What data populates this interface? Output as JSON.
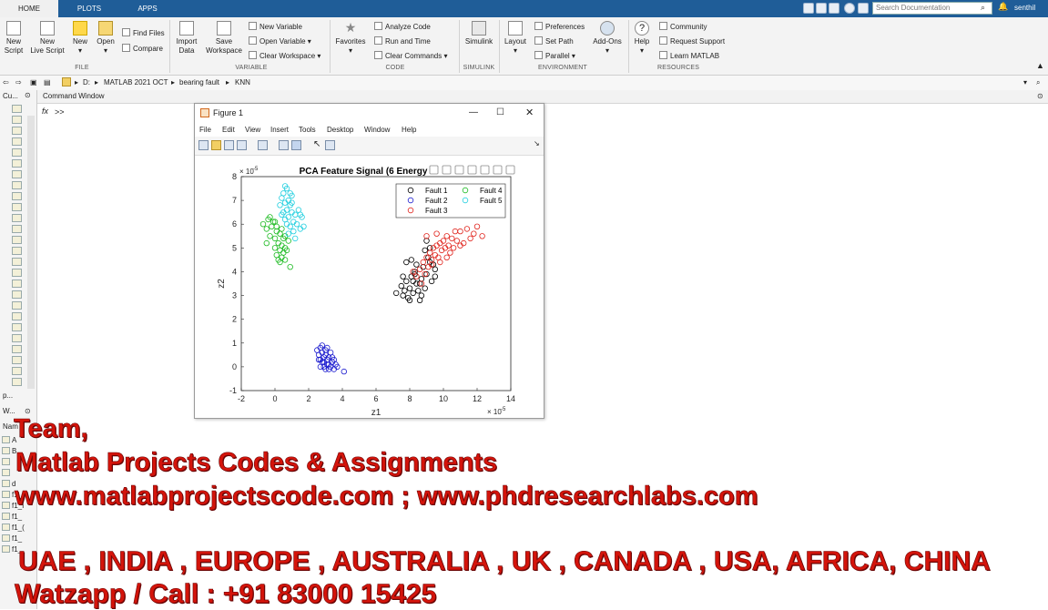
{
  "tabs": [
    {
      "label": "HOME",
      "active": true
    },
    {
      "label": "PLOTS",
      "active": false
    },
    {
      "label": "APPS",
      "active": false
    }
  ],
  "search": {
    "placeholder": "Search Documentation"
  },
  "user": {
    "name": "senthil"
  },
  "ribbon": {
    "file": {
      "group": "FILE",
      "new_script": "New\nScript",
      "new_live_script": "New\nLive Script",
      "new": "New",
      "open": "Open",
      "find_files": "Find Files",
      "compare": "Compare"
    },
    "variable": {
      "group": "VARIABLE",
      "import_data": "Import\nData",
      "save_workspace": "Save\nWorkspace",
      "new_variable": "New Variable",
      "open_variable": "Open Variable ▾",
      "clear_workspace": "Clear Workspace ▾"
    },
    "code": {
      "group": "CODE",
      "favorites": "Favorites",
      "analyze_code": "Analyze Code",
      "run_and_time": "Run and Time",
      "clear_commands": "Clear Commands ▾"
    },
    "simulink": {
      "group": "SIMULINK",
      "simulink": "Simulink"
    },
    "environment": {
      "group": "ENVIRONMENT",
      "layout": "Layout",
      "preferences": "Preferences",
      "set_path": "Set Path",
      "parallel": "Parallel ▾",
      "add_ons": "Add-Ons"
    },
    "resources": {
      "group": "RESOURCES",
      "help": "Help",
      "community": "Community",
      "request_support": "Request Support",
      "learn_matlab": "Learn MATLAB"
    }
  },
  "address": {
    "drive": "D:",
    "folder1": "MATLAB 2021 OCT",
    "folder2": "bearing fault",
    "folder3": "KNN"
  },
  "left_panel": {
    "current_folder": "Cu...",
    "workspace_short": "p...",
    "workspace": "W...",
    "name_col": "Nam",
    "items": [
      "A",
      "B",
      "",
      "",
      "d",
      "f1_",
      "f1_I",
      "f1_",
      "f1_(",
      "f1_",
      "f1_"
    ]
  },
  "command_window": {
    "title": "Command Window",
    "prompt": ">>",
    "fx": "fx"
  },
  "figure": {
    "title": "Figure 1",
    "menu": [
      "File",
      "Edit",
      "View",
      "Insert",
      "Tools",
      "Desktop",
      "Window",
      "Help"
    ]
  },
  "chart_data": {
    "type": "scatter",
    "title": "PCA Feature Signal (6 Energy",
    "xlabel": "z1",
    "ylabel": "z2",
    "x_exponent": "× 10",
    "x_exponent_power": "-5",
    "y_exponent": "× 10",
    "y_exponent_power": "-5",
    "xlim": [
      -2,
      14
    ],
    "ylim": [
      -1,
      8
    ],
    "xticks": [
      "-2",
      "0",
      "2",
      "4",
      "6",
      "8",
      "10",
      "12",
      "14"
    ],
    "yticks": [
      "-1",
      "0",
      "1",
      "2",
      "3",
      "4",
      "5",
      "6",
      "7",
      "8"
    ],
    "legend_position": "top-right",
    "marker": "open circle",
    "series": [
      {
        "name": "Fault 1",
        "color": "#000000",
        "points": [
          [
            7.2,
            3.1
          ],
          [
            7.5,
            3.4
          ],
          [
            7.6,
            3.0
          ],
          [
            7.8,
            3.6
          ],
          [
            7.9,
            2.9
          ],
          [
            8.0,
            3.3
          ],
          [
            8.1,
            3.8
          ],
          [
            8.2,
            3.1
          ],
          [
            8.3,
            4.0
          ],
          [
            8.4,
            3.5
          ],
          [
            8.5,
            3.2
          ],
          [
            8.6,
            2.8
          ],
          [
            8.7,
            3.7
          ],
          [
            8.8,
            4.2
          ],
          [
            8.9,
            3.3
          ],
          [
            9.0,
            3.9
          ],
          [
            9.1,
            4.6
          ],
          [
            9.2,
            4.4
          ],
          [
            9.3,
            3.6
          ],
          [
            9.5,
            4.1
          ],
          [
            7.8,
            4.4
          ],
          [
            8.1,
            4.5
          ],
          [
            8.0,
            2.8
          ],
          [
            8.6,
            3.5
          ],
          [
            9.0,
            5.3
          ],
          [
            9.5,
            3.8
          ],
          [
            8.3,
            3.9
          ],
          [
            8.7,
            3.0
          ],
          [
            7.7,
            3.2
          ],
          [
            9.4,
            4.3
          ],
          [
            8.2,
            3.6
          ],
          [
            8.9,
            4.9
          ],
          [
            8.4,
            4.3
          ],
          [
            7.6,
            3.8
          ],
          [
            9.2,
            5.0
          ]
        ]
      },
      {
        "name": "Fault 2",
        "color": "#1c1ccf",
        "points": [
          [
            2.5,
            0.7
          ],
          [
            2.6,
            0.5
          ],
          [
            2.7,
            0.8
          ],
          [
            2.7,
            0.3
          ],
          [
            2.8,
            0.6
          ],
          [
            2.8,
            0.9
          ],
          [
            2.9,
            0.4
          ],
          [
            2.9,
            0.2
          ],
          [
            3.0,
            0.7
          ],
          [
            3.0,
            0.5
          ],
          [
            3.1,
            0.3
          ],
          [
            3.1,
            0.8
          ],
          [
            3.2,
            0.1
          ],
          [
            3.2,
            0.4
          ],
          [
            3.3,
            0.0
          ],
          [
            3.3,
            0.6
          ],
          [
            3.4,
            0.2
          ],
          [
            3.5,
            -0.1
          ],
          [
            3.6,
            0.1
          ],
          [
            3.7,
            0.0
          ],
          [
            2.9,
            0.0
          ],
          [
            3.0,
            -0.1
          ],
          [
            4.1,
            -0.2
          ],
          [
            2.8,
            0.2
          ],
          [
            3.4,
            0.4
          ],
          [
            2.6,
            0.3
          ],
          [
            3.1,
            0.1
          ],
          [
            3.5,
            0.3
          ],
          [
            3.2,
            -0.1
          ],
          [
            2.7,
            0.0
          ]
        ]
      },
      {
        "name": "Fault 3",
        "color": "#e0231c",
        "points": [
          [
            8.4,
            3.8
          ],
          [
            8.6,
            4.1
          ],
          [
            8.8,
            4.4
          ],
          [
            8.9,
            3.9
          ],
          [
            9.0,
            4.6
          ],
          [
            9.1,
            4.2
          ],
          [
            9.2,
            4.8
          ],
          [
            9.3,
            4.5
          ],
          [
            9.4,
            5.0
          ],
          [
            9.5,
            4.7
          ],
          [
            9.6,
            5.1
          ],
          [
            9.7,
            4.6
          ],
          [
            9.8,
            5.2
          ],
          [
            9.9,
            4.9
          ],
          [
            10.0,
            5.3
          ],
          [
            10.1,
            5.0
          ],
          [
            10.2,
            5.5
          ],
          [
            10.3,
            5.1
          ],
          [
            10.4,
            4.8
          ],
          [
            10.5,
            5.4
          ],
          [
            10.6,
            5.0
          ],
          [
            10.8,
            5.3
          ],
          [
            11.0,
            5.7
          ],
          [
            11.2,
            5.2
          ],
          [
            11.4,
            5.8
          ],
          [
            11.6,
            5.4
          ],
          [
            11.8,
            5.6
          ],
          [
            12.0,
            5.9
          ],
          [
            12.3,
            5.5
          ],
          [
            8.7,
            3.5
          ],
          [
            9.0,
            5.5
          ],
          [
            9.6,
            5.6
          ],
          [
            10.2,
            4.6
          ],
          [
            11.0,
            5.1
          ],
          [
            9.3,
            4.3
          ],
          [
            8.2,
            4.0
          ],
          [
            10.7,
            5.7
          ],
          [
            9.8,
            4.4
          ]
        ]
      },
      {
        "name": "Fault 4",
        "color": "#1dbb22",
        "points": [
          [
            -0.7,
            6.0
          ],
          [
            -0.5,
            5.8
          ],
          [
            -0.4,
            6.2
          ],
          [
            -0.3,
            5.5
          ],
          [
            -0.2,
            5.9
          ],
          [
            -0.1,
            6.1
          ],
          [
            0.0,
            5.4
          ],
          [
            0.0,
            5.0
          ],
          [
            0.1,
            5.7
          ],
          [
            0.1,
            4.7
          ],
          [
            0.2,
            5.2
          ],
          [
            0.2,
            4.5
          ],
          [
            0.3,
            5.6
          ],
          [
            0.3,
            4.9
          ],
          [
            0.4,
            5.1
          ],
          [
            0.4,
            4.6
          ],
          [
            0.5,
            5.4
          ],
          [
            0.5,
            4.8
          ],
          [
            0.6,
            5.0
          ],
          [
            0.6,
            4.5
          ],
          [
            0.7,
            4.9
          ],
          [
            0.8,
            5.3
          ],
          [
            0.9,
            4.2
          ],
          [
            -0.3,
            6.3
          ],
          [
            0.0,
            6.1
          ],
          [
            0.3,
            4.4
          ],
          [
            0.1,
            5.9
          ],
          [
            -0.5,
            5.2
          ],
          [
            0.4,
            5.8
          ],
          [
            0.6,
            5.5
          ]
        ]
      },
      {
        "name": "Fault 5",
        "color": "#22cfdf",
        "points": [
          [
            0.3,
            6.8
          ],
          [
            0.4,
            7.1
          ],
          [
            0.5,
            6.5
          ],
          [
            0.5,
            7.3
          ],
          [
            0.6,
            6.9
          ],
          [
            0.6,
            6.2
          ],
          [
            0.7,
            7.5
          ],
          [
            0.7,
            6.6
          ],
          [
            0.8,
            7.0
          ],
          [
            0.8,
            6.3
          ],
          [
            0.9,
            6.8
          ],
          [
            0.9,
            5.9
          ],
          [
            1.0,
            6.5
          ],
          [
            1.0,
            7.2
          ],
          [
            1.1,
            6.1
          ],
          [
            1.1,
            5.7
          ],
          [
            1.2,
            6.4
          ],
          [
            1.3,
            6.0
          ],
          [
            1.4,
            6.6
          ],
          [
            1.5,
            5.8
          ],
          [
            1.6,
            6.3
          ],
          [
            1.7,
            5.9
          ],
          [
            0.4,
            6.4
          ],
          [
            0.6,
            7.6
          ],
          [
            0.8,
            5.6
          ],
          [
            1.0,
            6.9
          ],
          [
            1.2,
            5.4
          ],
          [
            1.5,
            6.4
          ],
          [
            0.9,
            7.3
          ],
          [
            0.7,
            6.0
          ]
        ]
      }
    ]
  },
  "overlay": {
    "line1": "Team,",
    "line2": "Matlab Projects Codes & Assignments",
    "line3": "www.matlabprojectscode.com ; www.phdresearchlabs.com",
    "line4": "UAE , INDIA , EUROPE , AUSTRALIA , UK , CANADA , USA, AFRICA, CHINA",
    "line5": "Watzapp / Call : +91 83000 15425"
  }
}
